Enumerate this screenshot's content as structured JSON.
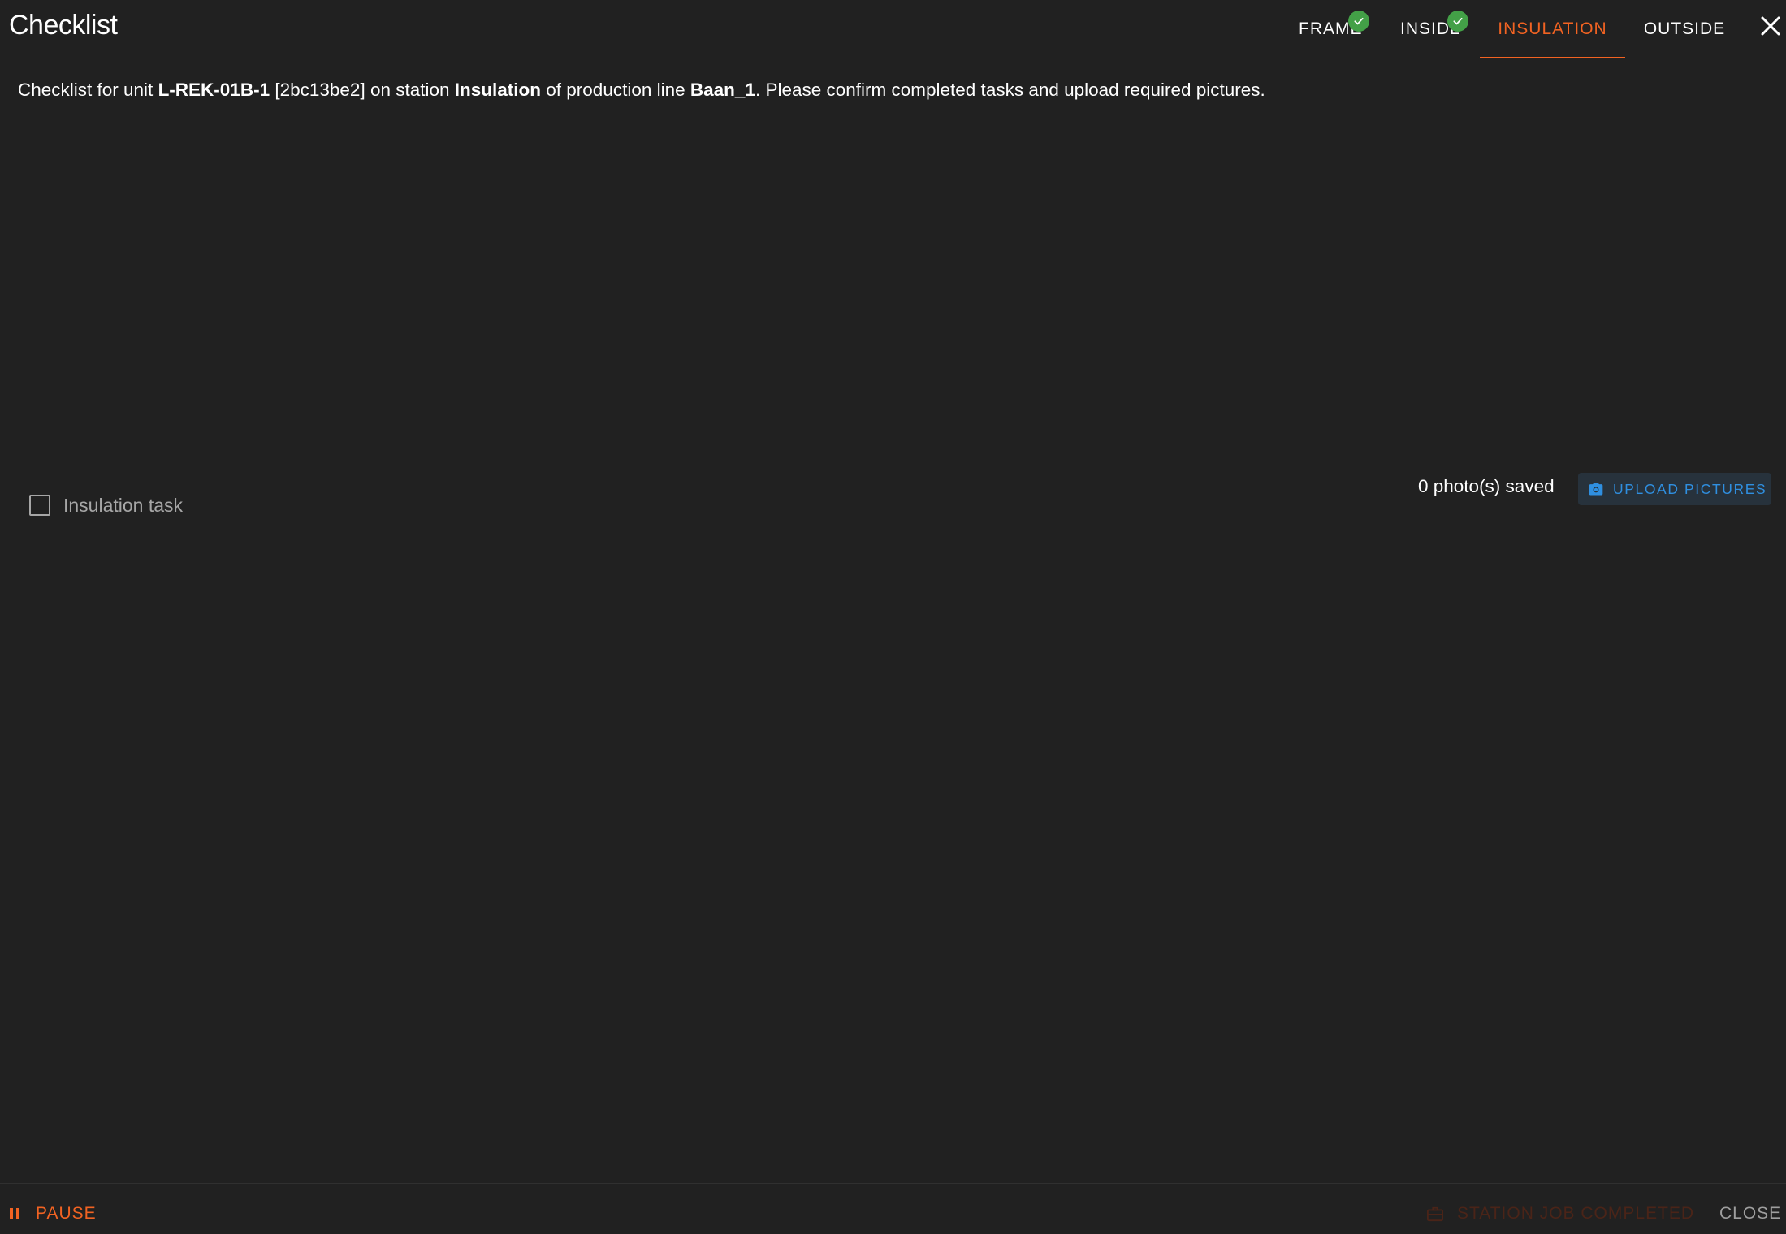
{
  "header": {
    "title": "Checklist",
    "tabs": [
      {
        "label": "FRAME",
        "completed": true
      },
      {
        "label": "INSIDE",
        "completed": true
      },
      {
        "label": "INSULATION",
        "completed": false,
        "active": true
      },
      {
        "label": "OUTSIDE",
        "completed": false
      }
    ],
    "close_icon": "close-icon"
  },
  "intro": {
    "prefix": "Checklist for unit ",
    "unit": "L-REK-01B-1",
    "unit_id": " [2bc13be2] on station ",
    "station": "Insulation",
    "mid": " of production line ",
    "line": "Baan_1",
    "suffix": ". Please confirm completed tasks and upload required pictures."
  },
  "task": {
    "label": "Insulation task",
    "checked": false
  },
  "photos": {
    "saved_text": "0 photo(s) saved",
    "upload_label": "UPLOAD PICTURES",
    "upload_icon": "camera-icon"
  },
  "footer": {
    "pause_label": "PAUSE",
    "pause_icon": "pause-icon",
    "job_completed_label": "STATION JOB COMPLETED",
    "job_completed_icon": "briefcase-icon",
    "close_label": "CLOSE"
  },
  "colors": {
    "background": "#212121",
    "accent": "#f26322",
    "success": "#43a047",
    "link_blue": "#2f8fe0"
  }
}
